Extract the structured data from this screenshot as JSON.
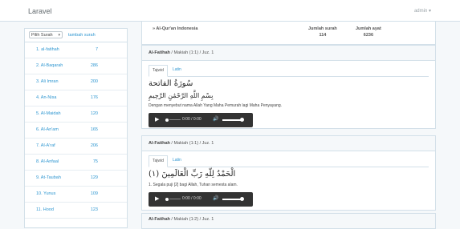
{
  "navbar": {
    "brand": "Laravel",
    "user": "admin ▾"
  },
  "sidebar": {
    "select_label": "Pilih Surah",
    "add_link": "tambah surah",
    "items": [
      {
        "name": "1. al-fatihah",
        "count": "7"
      },
      {
        "name": "2. Al-Baqarah",
        "count": "286"
      },
      {
        "name": "3. Ali Imran",
        "count": "200"
      },
      {
        "name": "4. An-Nisa",
        "count": "176"
      },
      {
        "name": "5. Al-Maidah",
        "count": "120"
      },
      {
        "name": "6. Al-An'am",
        "count": "165"
      },
      {
        "name": "7. Al-A'raf",
        "count": "206"
      },
      {
        "name": "8. Al-Anfaal",
        "count": "75"
      },
      {
        "name": "9. At-Taubah",
        "count": "129"
      },
      {
        "name": "10. Yunus",
        "count": "109"
      },
      {
        "name": "11. Hood",
        "count": "123"
      }
    ]
  },
  "header": {
    "title": "» Al-Qur'an Indonesia",
    "surah_label": "Jumlah surah",
    "surah_value": "114",
    "ayat_label": "Jumlah ayat",
    "ayat_value": "6236"
  },
  "cards": [
    {
      "surah": "Al-Fatihah",
      "meta": " / Makiah (1:1) / Juz. 1",
      "tab_active": "Tajwid",
      "tab_other": "Latin",
      "sura_title": "سُورَةُ الفاتحة",
      "arabic": "بِسْمِ اللَّهِ الرَّحْمَٰنِ الرَّحِيمِ",
      "translation": "Dengan menyebut nama Allah Yang Maha Pemurah lagi Maha Penyayang.",
      "time": "0:00 / 0:00"
    },
    {
      "surah": "Al-Fatihah",
      "meta": " / Makiah (1:1) / Juz. 1",
      "tab_active": "Tajwid",
      "tab_other": "Latin",
      "arabic": "الْحَمْدُ لِلَّهِ رَبِّ الْعَالَمِينَ (١)",
      "translation": "1. Segala puji [2] bagi Allah, Tuhan semesta alam.",
      "time": "0:00 / 0:00"
    },
    {
      "surah": "Al-Fatihah",
      "meta": " / Makiah (1:2) / Juz. 1"
    }
  ]
}
